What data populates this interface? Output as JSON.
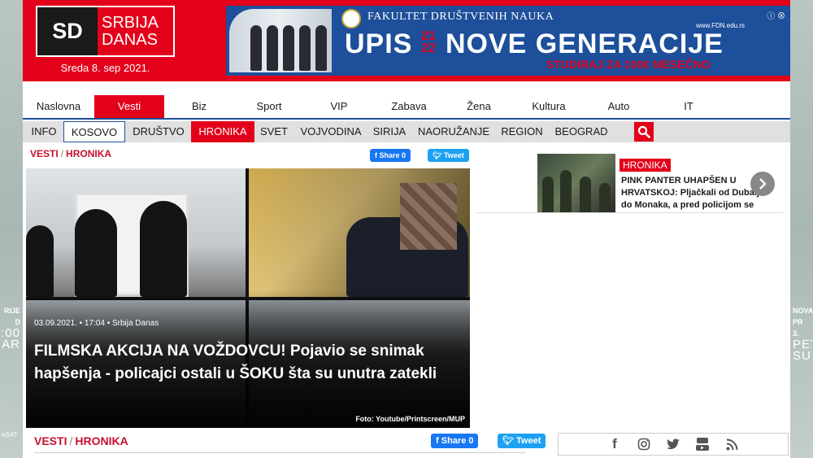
{
  "header": {
    "logo_sd": "SD",
    "logo_line1": "SRBIJA",
    "logo_line2": "DANAS",
    "date": "Sreda 8. sep 2021."
  },
  "banner": {
    "faculty": "FAKULTET DRUŠTVENIH NAUKA",
    "url": "www.FDN.edu.rs",
    "upis": "UPIS",
    "year_top": "21",
    "year_bottom": "22",
    "headline": "NOVE GENERACIJE",
    "subline": "STUDIRAJ ZA 100€ MESEČNO"
  },
  "nav_main": [
    {
      "label": "Naslovna",
      "active": false
    },
    {
      "label": "Vesti",
      "active": true
    },
    {
      "label": "Biz",
      "active": false
    },
    {
      "label": "Sport",
      "active": false
    },
    {
      "label": "VIP",
      "active": false
    },
    {
      "label": "Zabava",
      "active": false
    },
    {
      "label": "Žena",
      "active": false
    },
    {
      "label": "Kultura",
      "active": false
    },
    {
      "label": "Auto",
      "active": false
    },
    {
      "label": "IT",
      "active": false
    }
  ],
  "nav_sub": [
    {
      "label": "INFO",
      "style": ""
    },
    {
      "label": "KOSOVO",
      "style": "boxed"
    },
    {
      "label": "DRUŠTVO",
      "style": ""
    },
    {
      "label": "HRONIKA",
      "style": "active"
    },
    {
      "label": "SVET",
      "style": ""
    },
    {
      "label": "VOJVODINA",
      "style": ""
    },
    {
      "label": "SIRIJA",
      "style": ""
    },
    {
      "label": "NAORUŽANJE",
      "style": ""
    },
    {
      "label": "REGION",
      "style": ""
    },
    {
      "label": "BEOGRAD",
      "style": ""
    }
  ],
  "breadcrumb": {
    "section": "VESTI",
    "separator": "/",
    "category": "HRONIKA"
  },
  "share": {
    "facebook": "Share 0",
    "twitter": "Tweet"
  },
  "hero": {
    "meta": "03.09.2021. • 17:04 • Srbija Danas",
    "title": "FILMSKA AKCIJA NA VOŽDOVCU! Pojavio se snimak hapšenja - policajci ostali u ŠOKU šta su unutra zatekli",
    "credit": "Foto: Youtube/Printscreen/MUP"
  },
  "side_teaser": {
    "badge": "HRONIKA",
    "headline": "PINK PANTER UHAPŠEN U HRVATSKOJ:",
    "text": "Pljačkali od Dubaija do Monaka, a pred policijom se"
  },
  "bottom_breadcrumb": {
    "section": "VESTI",
    "separator": "/",
    "category": "HRONIKA"
  },
  "skin_left": {
    "line1": "RIJE",
    "line2": "D",
    "line3": ":00",
    "line4": "AR",
    "footer": "eSAT"
  },
  "skin_right": {
    "line1": "NOVA",
    "line2": "PR",
    "line3": "3.",
    "line4": "PET",
    "line5": "SU"
  },
  "colors": {
    "brand_red": "#e3001b",
    "brand_blue": "#1d4f9a",
    "facebook": "#1877f2",
    "twitter": "#1da1f2"
  }
}
